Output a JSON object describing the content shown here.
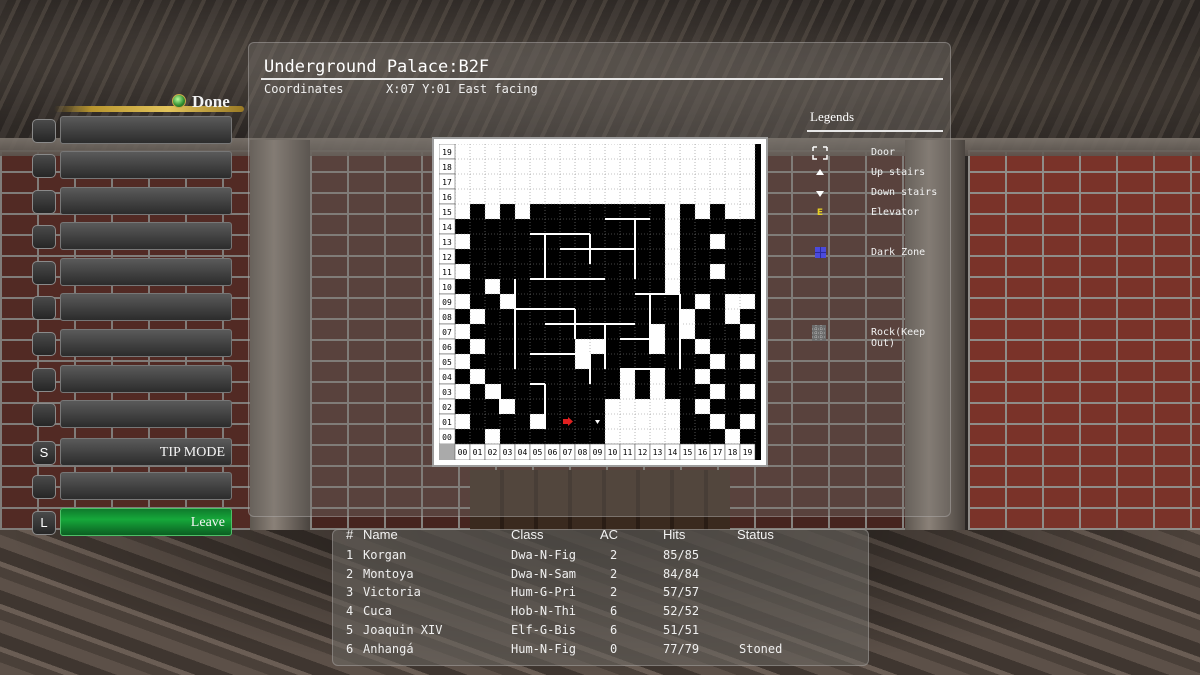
{
  "menu": {
    "done_label": "Done",
    "rows": [
      {
        "key": "",
        "label": ""
      },
      {
        "key": "",
        "label": ""
      },
      {
        "key": "",
        "label": ""
      },
      {
        "key": "",
        "label": ""
      },
      {
        "key": "",
        "label": ""
      },
      {
        "key": "",
        "label": ""
      },
      {
        "key": "",
        "label": ""
      },
      {
        "key": "",
        "label": ""
      },
      {
        "key": "",
        "label": ""
      },
      {
        "key": "S",
        "label": "TIP MODE"
      },
      {
        "key": "",
        "label": ""
      },
      {
        "key": "L",
        "label": "Leave"
      }
    ]
  },
  "map": {
    "title": "Underground Palace:B2F",
    "coordinates_label": "Coordinates",
    "coordinates_value": "X:07 Y:01 East facing",
    "player": {
      "x": 7,
      "y": 1,
      "facing": "east"
    },
    "x_labels": [
      "00",
      "01",
      "02",
      "03",
      "04",
      "05",
      "06",
      "07",
      "08",
      "09",
      "10",
      "11",
      "12",
      "13",
      "14",
      "15",
      "16",
      "17",
      "18",
      "19"
    ],
    "y_labels": [
      "19",
      "18",
      "17",
      "16",
      "15",
      "14",
      "13",
      "12",
      "11",
      "10",
      "09",
      "08",
      "07",
      "06",
      "05",
      "04",
      "03",
      "02",
      "01",
      "00"
    ],
    "rows": [
      "WWWWWWWWWWWWWWWWWWWW",
      "WWWWWWWWWWWWWWWWWWWW",
      "WWWWWWWWWWWWWWWWWWWW",
      "WWWWWWWWWWWWWWWWWWWW",
      "WBWBWBBBBBBBBBWBWBWW",
      "BBBBBBBBBBBBBBWBBBBB",
      "WBBBBBBBBBBBBBWBBWBB",
      "BBBBBBBBBBBBBBWBBBBB",
      "WBBBBBBBBBBBBBWBBWBB",
      "BBWBBBBBBBBBBBWBBBBB",
      "WBBWBBBBBBBBBBBBWBWW",
      "BWBBBBBBBBBBBBBWBBWB",
      "WBBBBBBBBBBBBWBWBBBW",
      "BWBBBBBBWWBBBWBBWBBB",
      "WBBBBBBBWBBBBBBBBWBW",
      "BWBBBBBBBBBWBWBBWBBB",
      "WBWBBBBBBBBWBWBBBWBW",
      "BBBWBBBBBBWWWWWBWBBB",
      "WBBBBWBBBBWWWWWBBWBW",
      "BBWBBBBBBBWWWWWBBBWB"
    ],
    "legend": {
      "title": "Legends",
      "items": [
        {
          "icon": "door-icon",
          "label": "Door"
        },
        {
          "icon": "up-stairs-icon",
          "label": "Up stairs"
        },
        {
          "icon": "down-stairs-icon",
          "label": "Down stairs"
        },
        {
          "icon": "elevator-icon",
          "label": "Elevator",
          "symbol": "E"
        },
        {
          "icon": "dark-zone-icon",
          "label": "Dark Zone"
        },
        {
          "icon": "rock-icon",
          "label": "Rock(Keep Out)"
        }
      ]
    }
  },
  "party": {
    "headers": {
      "num": "#",
      "name": "Name",
      "class": "Class",
      "ac": "AC",
      "hits": "Hits",
      "status": "Status"
    },
    "members": [
      {
        "num": "1",
        "name": "Korgan",
        "class": "Dwa-N-Fig",
        "ac": "2",
        "hits": "85/85",
        "status": ""
      },
      {
        "num": "2",
        "name": "Montoya",
        "class": "Dwa-N-Sam",
        "ac": "2",
        "hits": "84/84",
        "status": ""
      },
      {
        "num": "3",
        "name": "Victoria",
        "class": "Hum-G-Pri",
        "ac": "2",
        "hits": "57/57",
        "status": ""
      },
      {
        "num": "4",
        "name": "Cuca",
        "class": "Hob-N-Thi",
        "ac": "6",
        "hits": "52/52",
        "status": ""
      },
      {
        "num": "5",
        "name": "Joaquin XIV",
        "class": "Elf-G-Bis",
        "ac": "6",
        "hits": "51/51",
        "status": ""
      },
      {
        "num": "6",
        "name": "Anhangá",
        "class": "Hum-N-Fig",
        "ac": "0",
        "hits": "77/79",
        "status": "Stoned"
      }
    ]
  },
  "colors": {
    "player_arrow": "#e02020",
    "leave_button": "#16a83a",
    "elevator": "#e8d020",
    "dark_zone": "#4a4adc"
  }
}
